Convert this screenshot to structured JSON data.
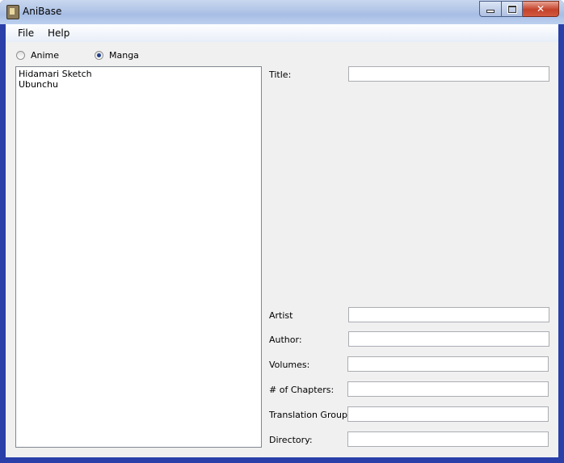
{
  "window": {
    "title": "AniBase"
  },
  "menu": {
    "file": "File",
    "help": "Help"
  },
  "mode": {
    "anime_label": "Anime",
    "manga_label": "Manga",
    "selected": "Manga"
  },
  "list": {
    "items": [
      "Hidamari Sketch",
      "Ubunchu"
    ]
  },
  "form": {
    "title_label": "Title:",
    "artist_label": "Artist",
    "author_label": "Author:",
    "volumes_label": "Volumes:",
    "chapters_label": "# of Chapters:",
    "translation_group_label": "Translation Group:",
    "directory_label": "Directory:",
    "title_value": "",
    "artist_value": "",
    "author_value": "",
    "volumes_value": "",
    "chapters_value": "",
    "translation_group_value": "",
    "directory_value": ""
  },
  "icons": {
    "app": "app-icon",
    "minimize": "minimize-icon",
    "maximize": "maximize-icon",
    "close": "close-icon"
  }
}
